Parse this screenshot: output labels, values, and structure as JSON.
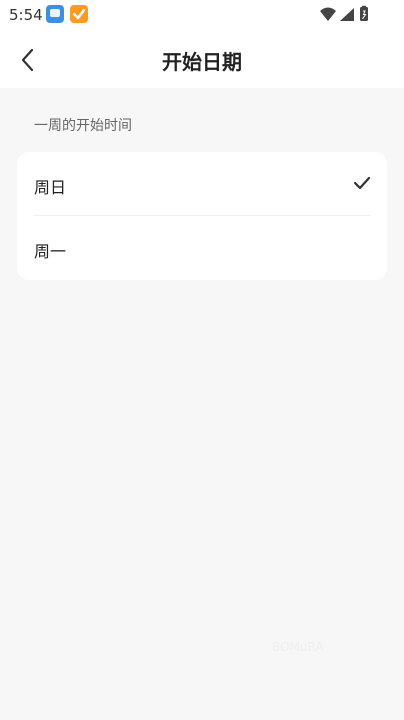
{
  "status_bar": {
    "time": "5:54",
    "icons": [
      "app-icon",
      "task-app-icon",
      "wifi-icon",
      "cellular-icon",
      "battery-icon"
    ]
  },
  "header": {
    "title": "开始日期",
    "back_icon": "chevron-left-icon"
  },
  "section": {
    "label": "一周的开始时间"
  },
  "options": [
    {
      "label": "周日",
      "selected": true
    },
    {
      "label": "周一",
      "selected": false
    }
  ],
  "watermark": "BOMuRA",
  "colors": {
    "background": "#f7f7f7",
    "card": "#ffffff",
    "text": "#222222",
    "muted": "#666666"
  }
}
